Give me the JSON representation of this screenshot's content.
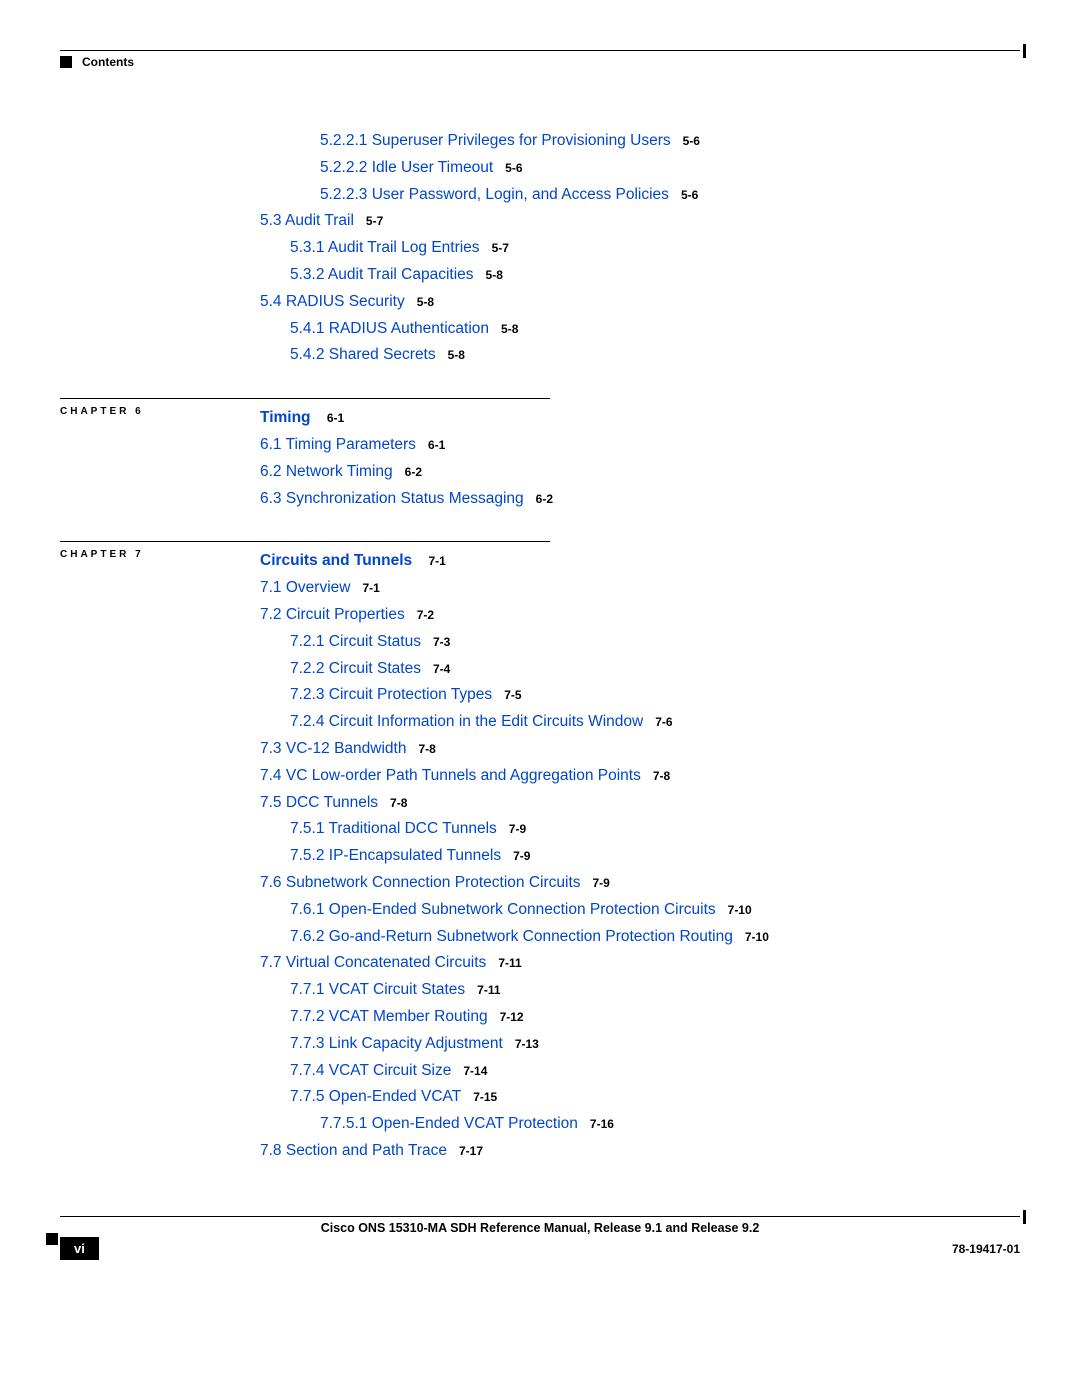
{
  "header": {
    "contents_label": "Contents"
  },
  "pre": [
    {
      "indent": "i3",
      "text": "5.2.2.1  Superuser Privileges for Provisioning Users",
      "page": "5-6"
    },
    {
      "indent": "i3",
      "text": "5.2.2.2  Idle User Timeout",
      "page": "5-6"
    },
    {
      "indent": "i3",
      "text": "5.2.2.3  User Password, Login, and Access Policies",
      "page": "5-6"
    },
    {
      "indent": "i1",
      "text": "5.3  Audit Trail",
      "page": "5-7"
    },
    {
      "indent": "i2",
      "text": "5.3.1  Audit Trail Log Entries",
      "page": "5-7"
    },
    {
      "indent": "i2",
      "text": "5.3.2  Audit Trail Capacities",
      "page": "5-8"
    },
    {
      "indent": "i1",
      "text": "5.4  RADIUS Security",
      "page": "5-8"
    },
    {
      "indent": "i2",
      "text": "5.4.1  RADIUS Authentication",
      "page": "5-8"
    },
    {
      "indent": "i2",
      "text": "5.4.2  Shared Secrets",
      "page": "5-8"
    }
  ],
  "ch6": {
    "label": "CHAPTER 6",
    "title": "Timing",
    "title_page": "6-1",
    "items": [
      {
        "indent": "i1",
        "text": "6.1  Timing Parameters",
        "page": "6-1"
      },
      {
        "indent": "i1",
        "text": "6.2  Network Timing",
        "page": "6-2"
      },
      {
        "indent": "i1",
        "text": "6.3  Synchronization Status Messaging",
        "page": "6-2"
      }
    ]
  },
  "ch7": {
    "label": "CHAPTER 7",
    "title": "Circuits and Tunnels",
    "title_page": "7-1",
    "items": [
      {
        "indent": "i1",
        "text": "7.1  Overview",
        "page": "7-1"
      },
      {
        "indent": "i1",
        "text": "7.2  Circuit Properties",
        "page": "7-2"
      },
      {
        "indent": "i2",
        "text": "7.2.1  Circuit Status",
        "page": "7-3"
      },
      {
        "indent": "i2",
        "text": "7.2.2  Circuit States",
        "page": "7-4"
      },
      {
        "indent": "i2",
        "text": "7.2.3  Circuit Protection Types",
        "page": "7-5"
      },
      {
        "indent": "i2",
        "text": "7.2.4  Circuit Information in the Edit Circuits Window",
        "page": "7-6"
      },
      {
        "indent": "i1",
        "text": "7.3  VC-12 Bandwidth",
        "page": "7-8"
      },
      {
        "indent": "i1",
        "text": "7.4  VC Low-order Path Tunnels and Aggregation Points",
        "page": "7-8"
      },
      {
        "indent": "i1",
        "text": "7.5  DCC Tunnels",
        "page": "7-8"
      },
      {
        "indent": "i2",
        "text": "7.5.1  Traditional DCC Tunnels",
        "page": "7-9"
      },
      {
        "indent": "i2",
        "text": "7.5.2  IP-Encapsulated Tunnels",
        "page": "7-9"
      },
      {
        "indent": "i1",
        "text": "7.6  Subnetwork Connection Protection Circuits",
        "page": "7-9"
      },
      {
        "indent": "i2",
        "text": "7.6.1  Open-Ended Subnetwork Connection Protection Circuits",
        "page": "7-10"
      },
      {
        "indent": "i2",
        "text": "7.6.2  Go-and-Return Subnetwork Connection Protection Routing",
        "page": "7-10"
      },
      {
        "indent": "i1",
        "text": "7.7  Virtual Concatenated Circuits",
        "page": "7-11"
      },
      {
        "indent": "i2",
        "text": "7.7.1  VCAT Circuit States",
        "page": "7-11"
      },
      {
        "indent": "i2",
        "text": "7.7.2  VCAT Member Routing",
        "page": "7-12"
      },
      {
        "indent": "i2",
        "text": "7.7.3  Link Capacity Adjustment",
        "page": "7-13"
      },
      {
        "indent": "i2",
        "text": "7.7.4  VCAT Circuit Size",
        "page": "7-14"
      },
      {
        "indent": "i2",
        "text": "7.7.5  Open-Ended VCAT",
        "page": "7-15"
      },
      {
        "indent": "i3",
        "text": "7.7.5.1  Open-Ended VCAT Protection",
        "page": "7-16"
      },
      {
        "indent": "i1",
        "text": "7.8  Section and Path Trace",
        "page": "7-17"
      }
    ]
  },
  "footer": {
    "title": "Cisco ONS 15310-MA SDH Reference Manual, Release 9.1 and Release 9.2",
    "page": "vi",
    "docnum": "78-19417-01"
  }
}
